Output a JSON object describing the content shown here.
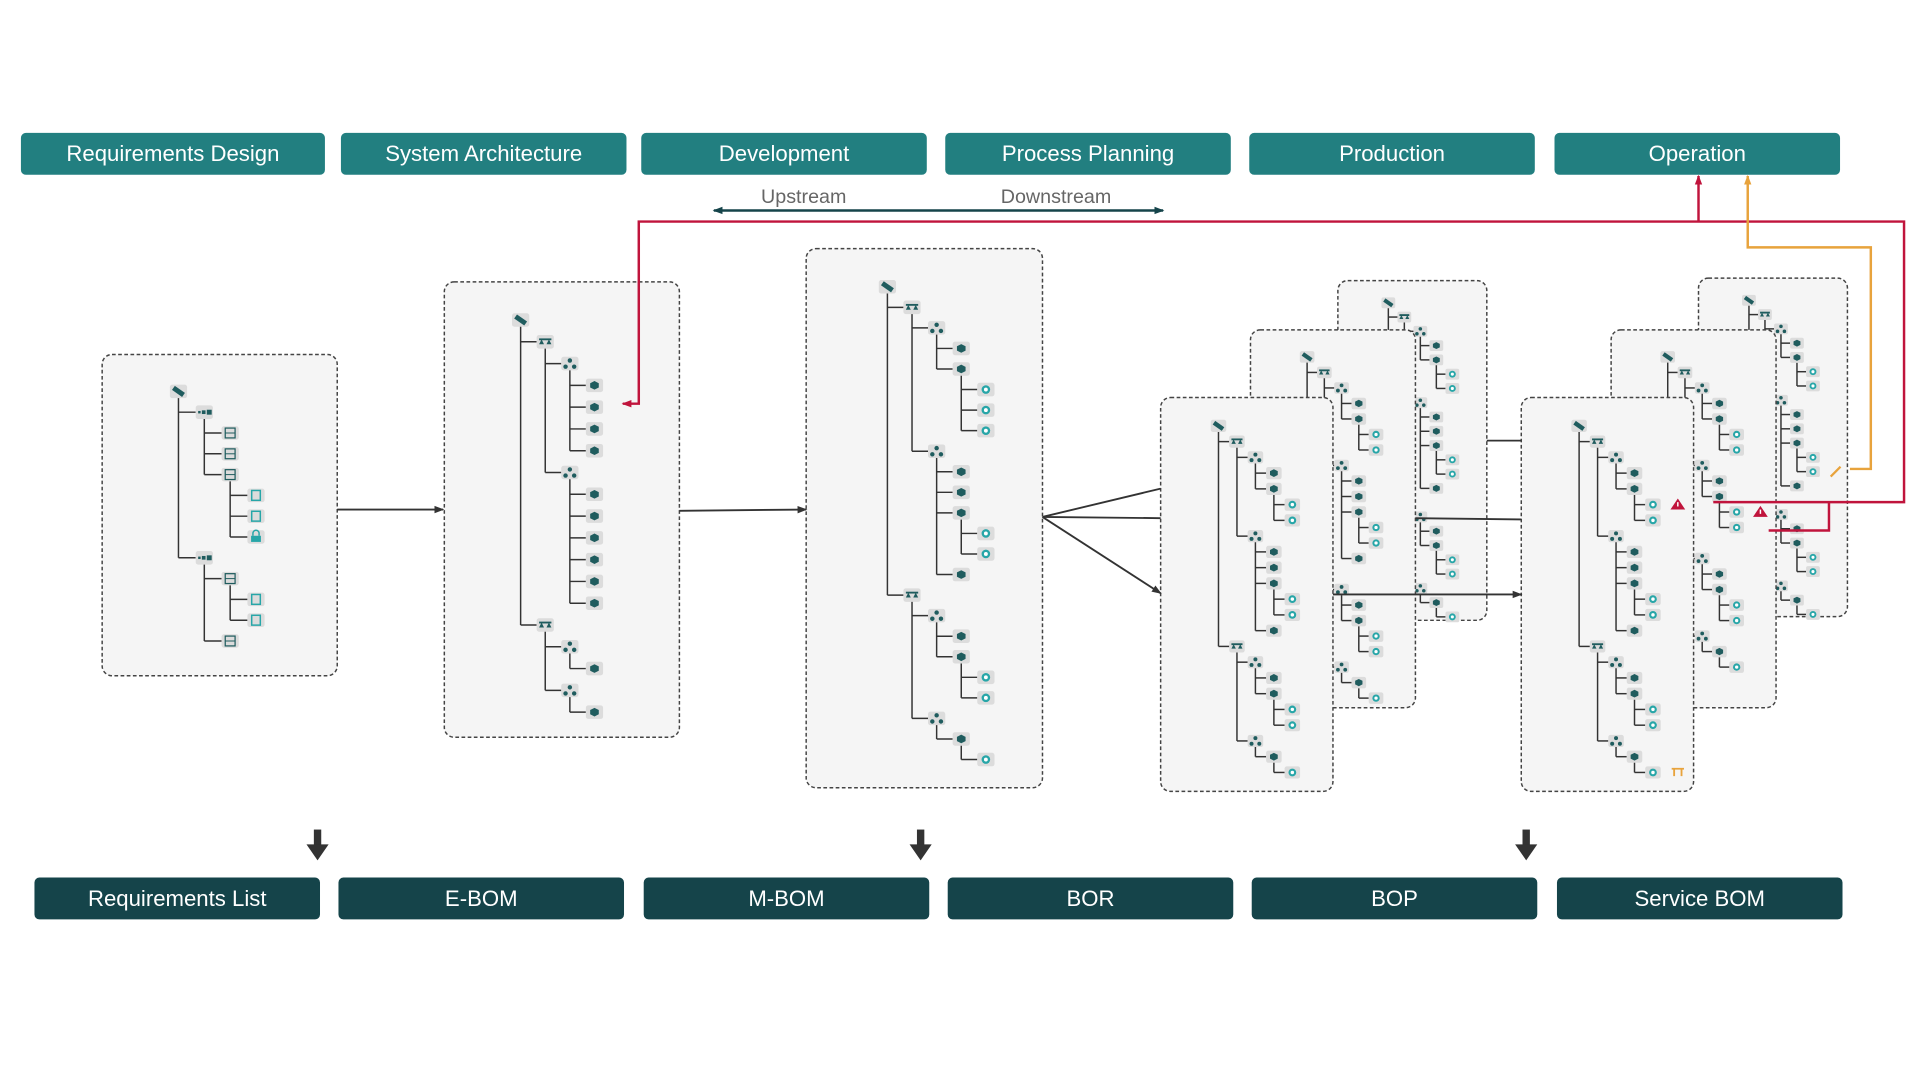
{
  "phases": [
    "Requirements Design",
    "System Architecture",
    "Development",
    "Process Planning",
    "Production",
    "Operation"
  ],
  "deliverables": [
    "Requirements List",
    "E-BOM",
    "M-BOM",
    "BOR",
    "BOP",
    "Service BOM"
  ],
  "flow": {
    "upstream": "Upstream",
    "downstream": "Downstream"
  },
  "colors": {
    "phase": "#227f80",
    "deliverable": "#15444a",
    "feedback_red": "#c0143c",
    "feedback_orange": "#e8a33c",
    "connector": "#333333",
    "panel_fill": "#f5f5f5"
  },
  "trees": {
    "requirements_list": [
      "satellite",
      [
        [
          "module",
          [
            [
              "sheet"
            ],
            [
              "sheet"
            ],
            [
              "sheet",
              [
                [
                  "doc"
                ],
                [
                  "doc"
                ],
                [
                  "lock"
                ]
              ]
            ]
          ]
        ],
        [
          "module",
          [
            [
              "sheet",
              [
                [
                  "doc"
                ],
                [
                  "doc"
                ]
              ]
            ],
            [
              "sheet"
            ]
          ]
        ]
      ]
    ],
    "e_bom": [
      "satellite",
      [
        [
          "balance",
          [
            [
              "network",
              [
                [
                  "cube"
                ],
                [
                  "cube"
                ],
                [
                  "cube"
                ],
                [
                  "cube"
                ]
              ]
            ],
            [
              "network",
              [
                [
                  "cube"
                ],
                [
                  "cube"
                ],
                [
                  "cube"
                ],
                [
                  "cube"
                ],
                [
                  "cube"
                ],
                [
                  "cube"
                ]
              ]
            ]
          ]
        ],
        [
          "balance",
          [
            [
              "network",
              [
                [
                  "cube"
                ]
              ]
            ],
            [
              "network",
              [
                [
                  "cube"
                ]
              ]
            ]
          ]
        ]
      ]
    ],
    "m_bom": [
      "satellite",
      [
        [
          "balance",
          [
            [
              "network",
              [
                [
                  "cube"
                ],
                [
                  "cube",
                  [
                    [
                      "gear"
                    ],
                    [
                      "gear"
                    ],
                    [
                      "gear"
                    ]
                  ]
                ]
              ]
            ],
            [
              "network",
              [
                [
                  "cube"
                ],
                [
                  "cube"
                ],
                [
                  "cube",
                  [
                    [
                      "gear"
                    ],
                    [
                      "gear"
                    ]
                  ]
                ],
                [
                  "cube"
                ]
              ]
            ]
          ]
        ],
        [
          "balance",
          [
            [
              "network",
              [
                [
                  "cube"
                ],
                [
                  "cube",
                  [
                    [
                      "gear"
                    ],
                    [
                      "gear"
                    ]
                  ]
                ]
              ]
            ],
            [
              "network",
              [
                [
                  "cube",
                  [
                    [
                      "gear"
                    ]
                  ]
                ]
              ]
            ]
          ]
        ]
      ]
    ],
    "bor": [
      "satellite",
      [
        [
          "balance",
          [
            [
              "network",
              [
                [
                  "cube"
                ],
                [
                  "cube",
                  [
                    [
                      "gear"
                    ],
                    [
                      "gear"
                    ]
                  ]
                ]
              ]
            ],
            [
              "network",
              [
                [
                  "cube"
                ],
                [
                  "cube"
                ],
                [
                  "cube",
                  [
                    [
                      "gear"
                    ],
                    [
                      "gear"
                    ]
                  ]
                ],
                [
                  "cube"
                ]
              ]
            ]
          ]
        ],
        [
          "balance",
          [
            [
              "network",
              [
                [
                  "cube"
                ],
                [
                  "cube",
                  [
                    [
                      "gear"
                    ],
                    [
                      "gear"
                    ]
                  ]
                ]
              ]
            ],
            [
              "network",
              [
                [
                  "cube",
                  [
                    [
                      "gear"
                    ]
                  ]
                ]
              ]
            ]
          ]
        ]
      ]
    ],
    "bop_front": [
      "satellite",
      [
        [
          "balance",
          [
            [
              "network",
              [
                [
                  "cube"
                ],
                [
                  "cube",
                  [
                    [
                      "gear",
                      [],
                      "warning"
                    ],
                    [
                      "gear"
                    ]
                  ]
                ]
              ]
            ],
            [
              "network",
              [
                [
                  "cube"
                ],
                [
                  "cube"
                ],
                [
                  "cube",
                  [
                    [
                      "gear"
                    ],
                    [
                      "gear"
                    ]
                  ]
                ],
                [
                  "cube"
                ]
              ]
            ]
          ]
        ],
        [
          "balance",
          [
            [
              "network",
              [
                [
                  "cube"
                ],
                [
                  "cube",
                  [
                    [
                      "gear"
                    ],
                    [
                      "gear"
                    ]
                  ]
                ]
              ]
            ],
            [
              "network",
              [
                [
                  "cube",
                  [
                    [
                      "gear",
                      [],
                      "tool"
                    ]
                  ]
                ]
              ]
            ]
          ]
        ]
      ]
    ],
    "bop_mid": [
      "satellite",
      [
        [
          "balance",
          [
            [
              "network",
              [
                [
                  "cube"
                ],
                [
                  "cube",
                  [
                    [
                      "gear"
                    ],
                    [
                      "gear"
                    ]
                  ]
                ]
              ]
            ],
            [
              "network",
              [
                [
                  "cube"
                ],
                [
                  "cube",
                  [
                    [
                      "gear",
                      [],
                      "warning"
                    ],
                    [
                      "gear"
                    ]
                  ]
                ]
              ]
            ]
          ]
        ],
        [
          "balance",
          [
            [
              "network",
              [
                [
                  "cube"
                ],
                [
                  "cube",
                  [
                    [
                      "gear"
                    ],
                    [
                      "gear"
                    ]
                  ]
                ]
              ]
            ],
            [
              "network",
              [
                [
                  "cube",
                  [
                    [
                      "gear"
                    ]
                  ]
                ]
              ]
            ]
          ]
        ]
      ]
    ],
    "bop_back": [
      "satellite",
      [
        [
          "balance",
          [
            [
              "network",
              [
                [
                  "cube"
                ],
                [
                  "cube",
                  [
                    [
                      "gear"
                    ],
                    [
                      "gear"
                    ]
                  ]
                ]
              ]
            ],
            [
              "network",
              [
                [
                  "cube"
                ],
                [
                  "cube"
                ],
                [
                  "cube",
                  [
                    [
                      "gear"
                    ],
                    [
                      "gear",
                      [],
                      "wrench"
                    ]
                  ]
                ],
                [
                  "cube"
                ]
              ]
            ]
          ]
        ],
        [
          "balance",
          [
            [
              "network",
              [
                [
                  "cube"
                ],
                [
                  "cube",
                  [
                    [
                      "gear"
                    ],
                    [
                      "gear"
                    ]
                  ]
                ]
              ]
            ],
            [
              "network",
              [
                [
                  "cube",
                  [
                    [
                      "gear"
                    ]
                  ]
                ]
              ]
            ]
          ]
        ]
      ]
    ]
  }
}
